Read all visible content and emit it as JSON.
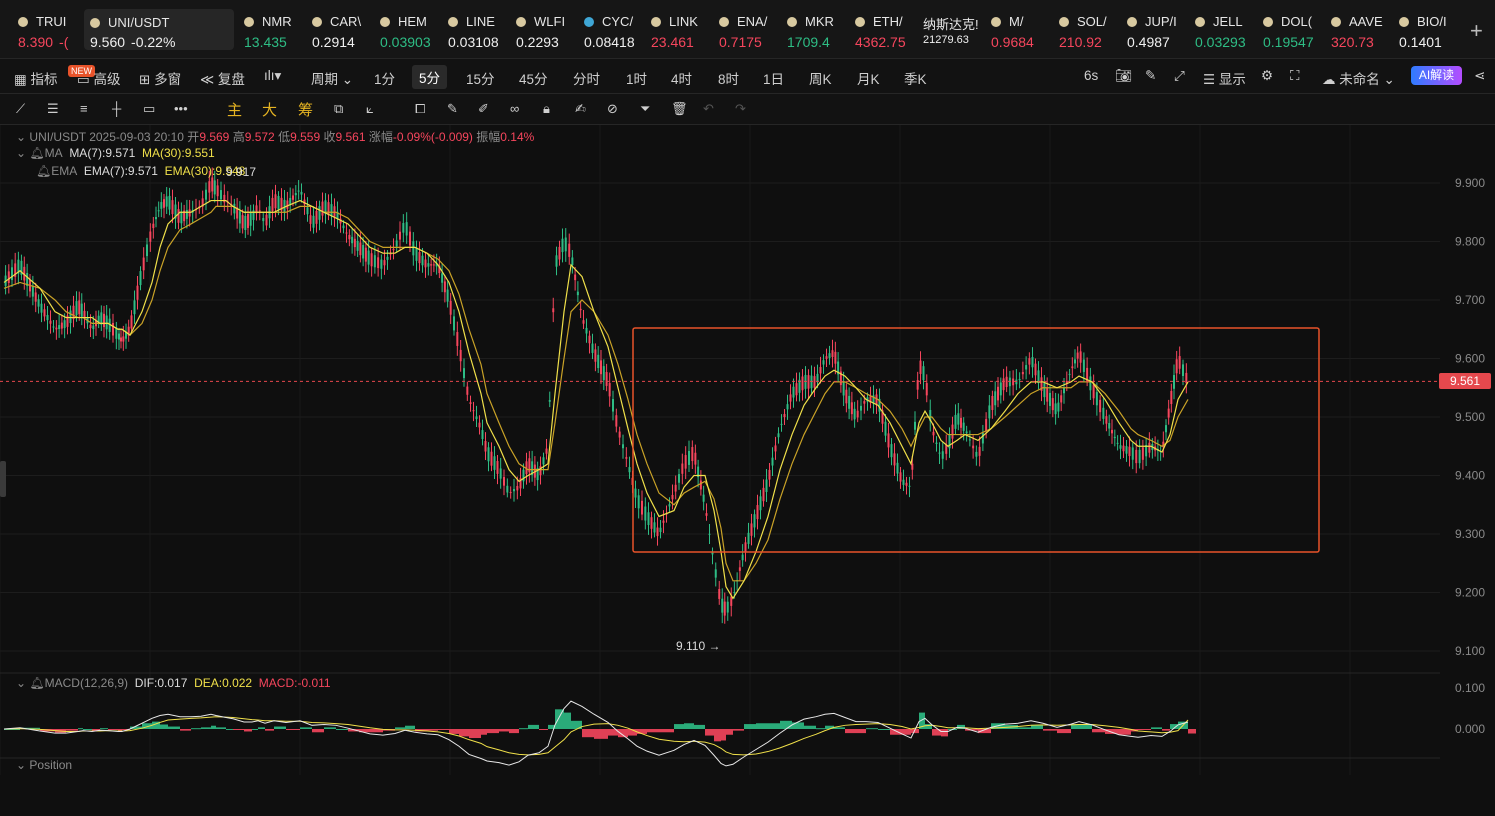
{
  "ticker": {
    "items": [
      {
        "symbol": "TRUI",
        "price": "8.390",
        "change": "-(",
        "dir": "dn"
      },
      {
        "symbol": "UNI/USDT",
        "price": "9.560",
        "change": "-0.22%",
        "dir": "wh"
      },
      {
        "symbol": "NMR",
        "price": "13.435",
        "change": "",
        "dir": "up"
      },
      {
        "symbol": "CAR\\",
        "price": "0.2914",
        "change": "",
        "dir": "wh"
      },
      {
        "symbol": "HEM",
        "price": "0.03903",
        "change": "",
        "dir": "up"
      },
      {
        "symbol": "LINE",
        "price": "0.03108",
        "change": "",
        "dir": "wh"
      },
      {
        "symbol": "WLFI",
        "price": "0.2293",
        "change": "",
        "dir": "wh"
      },
      {
        "symbol": "CYC/",
        "price": "0.08418",
        "change": "",
        "dir": "wh"
      },
      {
        "symbol": "LINK",
        "price": "23.461",
        "change": "",
        "dir": "dn"
      },
      {
        "symbol": "ENA/",
        "price": "0.7175",
        "change": "",
        "dir": "dn"
      },
      {
        "symbol": "MKR",
        "price": "1709.4",
        "change": "",
        "dir": "up"
      },
      {
        "symbol": "ETH/",
        "price": "4362.75",
        "change": "",
        "dir": "dn"
      },
      {
        "symbol": "纳斯达克!",
        "price": "21279.63",
        "change": "",
        "dir": "wh"
      },
      {
        "symbol": "M/",
        "price": "0.9684",
        "change": "",
        "dir": "dn"
      },
      {
        "symbol": "SOL/",
        "price": "210.92",
        "change": "",
        "dir": "dn"
      },
      {
        "symbol": "JUP/I",
        "price": "0.4987",
        "change": "",
        "dir": "wh"
      },
      {
        "symbol": "JELL",
        "price": "0.03293",
        "change": "",
        "dir": "up"
      },
      {
        "symbol": "DOL(",
        "price": "0.19547",
        "change": "",
        "dir": "up"
      },
      {
        "symbol": "AAVE",
        "price": "320.73",
        "change": "",
        "dir": "dn"
      },
      {
        "symbol": "BIO/I",
        "price": "0.1401",
        "change": "",
        "dir": "wh"
      }
    ],
    "add_label": "+"
  },
  "toolbar": {
    "indicator": "指标",
    "new_badge": "NEW",
    "advanced": "高级",
    "multi": "多窗",
    "replay": "复盘",
    "chart_type": "▾",
    "period": "周期",
    "intervals": [
      "1分",
      "5分",
      "15分",
      "45分",
      "分时",
      "1时",
      "4时",
      "8时",
      "1日",
      "周K",
      "月K",
      "季K"
    ],
    "selected_interval": "5分",
    "refresh": "6s",
    "display": "显示",
    "layout_name": "未命名",
    "ai": "AI解读"
  },
  "drawbar": {
    "main": "主",
    "big": "大",
    "chip": "筹"
  },
  "chart": {
    "pair_line": {
      "pair": "UNI/USDT",
      "datetime": "2025-09-03 20:10",
      "open_l": "开",
      "open": "9.569",
      "high_l": "高",
      "high": "9.572",
      "low_l": "低",
      "low": "9.559",
      "close_l": "收",
      "close": "9.561",
      "chg_l": "涨幅",
      "chg": "-0.09%(-0.009)",
      "amp_l": "振幅",
      "amp": "0.14%"
    },
    "ma_line": {
      "name": "MA",
      "ma7": "MA(7):9.571",
      "ma30": "MA(30):9.551"
    },
    "ema_line": {
      "name": "EMA",
      "ema7": "EMA(7):9.571",
      "ema30": "EMA(30):9.548"
    },
    "high_marker": "9.917",
    "low_marker": "9.110 →",
    "last_price": "9.561",
    "price_axis": [
      "9.900",
      "9.800",
      "9.700",
      "9.600",
      "9.500",
      "9.400",
      "9.300",
      "9.200",
      "9.100"
    ],
    "macd_line": {
      "name": "MACD(12,26,9)",
      "dif": "DIF:0.017",
      "dea": "DEA:0.022",
      "macd": "MACD:-0.011"
    },
    "macd_axis": [
      "0.100",
      "0.000"
    ],
    "position_label": "Position",
    "colors": {
      "up": "#2ebd85",
      "down": "#f6465d",
      "ma7": "#f0e04a",
      "ma30": "#c9a227",
      "box": "#e8532a"
    }
  },
  "chart_data": {
    "type": "line",
    "title": "UNI/USDT",
    "ylim": [
      9.07,
      9.96
    ],
    "x": [
      0,
      16,
      36,
      51,
      62,
      74,
      79,
      88,
      96,
      104,
      114,
      118,
      126,
      138,
      148,
      156,
      164,
      176,
      187,
      197,
      207,
      212,
      222,
      229,
      240,
      248,
      254,
      261,
      270,
      282,
      296,
      308,
      320,
      332,
      344,
      355,
      366,
      379,
      391,
      401,
      411,
      423,
      434,
      445,
      455,
      465,
      477,
      483,
      495,
      505,
      515,
      524,
      535,
      544,
      551,
      560,
      567,
      578,
      590,
      604,
      614,
      624,
      633,
      643,
      655,
      670,
      680,
      690,
      701,
      710,
      717,
      722,
      729,
      740,
      752,
      764,
      776,
      788,
      800,
      812,
      821,
      830,
      841,
      852,
      862,
      874,
      886,
      898,
      907,
      915,
      921,
      928,
      937,
      944,
      953,
      961,
      974,
      987,
      1001,
      1014,
      1027,
      1039,
      1053,
      1067,
      1075,
      1088,
      1101,
      1115,
      1127,
      1134,
      1147,
      1158,
      1166,
      1174,
      1184
    ],
    "close": [
      9.73,
      9.76,
      9.69,
      9.65,
      9.66,
      9.69,
      9.68,
      9.65,
      9.67,
      9.66,
      9.64,
      9.63,
      9.65,
      9.75,
      9.82,
      9.86,
      9.87,
      9.84,
      9.85,
      9.86,
      9.9,
      9.89,
      9.87,
      9.86,
      9.83,
      9.84,
      9.86,
      9.83,
      9.87,
      9.86,
      9.89,
      9.83,
      9.86,
      9.85,
      9.81,
      9.79,
      9.77,
      9.76,
      9.79,
      9.83,
      9.78,
      9.76,
      9.76,
      9.7,
      9.62,
      9.53,
      9.48,
      9.44,
      9.41,
      9.37,
      9.38,
      9.42,
      9.4,
      9.45,
      9.76,
      9.8,
      9.78,
      9.67,
      9.61,
      9.56,
      9.48,
      9.42,
      9.36,
      9.33,
      9.3,
      9.37,
      9.42,
      9.44,
      9.35,
      9.25,
      9.18,
      9.17,
      9.19,
      9.27,
      9.33,
      9.39,
      9.48,
      9.54,
      9.56,
      9.56,
      9.6,
      9.61,
      9.54,
      9.5,
      9.53,
      9.53,
      9.45,
      9.39,
      9.38,
      9.59,
      9.57,
      9.48,
      9.43,
      9.45,
      9.5,
      9.48,
      9.43,
      9.52,
      9.56,
      9.56,
      9.6,
      9.55,
      9.51,
      9.58,
      9.61,
      9.55,
      9.5,
      9.45,
      9.44,
      9.43,
      9.45,
      9.44,
      9.52,
      9.6,
      9.56
    ],
    "ma7": [
      9.73,
      9.75,
      9.72,
      9.68,
      9.67,
      9.67,
      9.67,
      9.67,
      9.66,
      9.66,
      9.65,
      9.65,
      9.64,
      9.68,
      9.73,
      9.79,
      9.83,
      9.85,
      9.85,
      9.86,
      9.87,
      9.87,
      9.87,
      9.86,
      9.85,
      9.85,
      9.85,
      9.85,
      9.85,
      9.86,
      9.87,
      9.86,
      9.85,
      9.84,
      9.83,
      9.81,
      9.79,
      9.78,
      9.78,
      9.79,
      9.79,
      9.78,
      9.76,
      9.73,
      9.68,
      9.61,
      9.54,
      9.49,
      9.45,
      9.41,
      9.39,
      9.4,
      9.41,
      9.42,
      9.54,
      9.68,
      9.76,
      9.74,
      9.68,
      9.62,
      9.55,
      9.48,
      9.42,
      9.37,
      9.33,
      9.34,
      9.38,
      9.4,
      9.4,
      9.34,
      9.27,
      9.21,
      9.19,
      9.22,
      9.27,
      9.33,
      9.41,
      9.47,
      9.52,
      9.55,
      9.57,
      9.58,
      9.57,
      9.55,
      9.53,
      9.52,
      9.49,
      9.45,
      9.42,
      9.49,
      9.51,
      9.49,
      9.46,
      9.45,
      9.46,
      9.47,
      9.46,
      9.48,
      9.51,
      9.54,
      9.56,
      9.56,
      9.55,
      9.56,
      9.57,
      9.56,
      9.53,
      9.49,
      9.46,
      9.45,
      9.45,
      9.44,
      9.47,
      9.53,
      9.56
    ],
    "ma30": [
      9.72,
      9.73,
      9.72,
      9.7,
      9.68,
      9.67,
      9.67,
      9.66,
      9.66,
      9.66,
      9.65,
      9.65,
      9.64,
      9.66,
      9.7,
      9.75,
      9.79,
      9.82,
      9.83,
      9.84,
      9.85,
      9.86,
      9.86,
      9.86,
      9.85,
      9.85,
      9.85,
      9.85,
      9.85,
      9.85,
      9.86,
      9.86,
      9.85,
      9.85,
      9.84,
      9.82,
      9.8,
      9.79,
      9.79,
      9.79,
      9.79,
      9.78,
      9.77,
      9.75,
      9.71,
      9.65,
      9.59,
      9.54,
      9.49,
      9.45,
      9.42,
      9.41,
      9.41,
      9.41,
      9.49,
      9.6,
      9.68,
      9.7,
      9.68,
      9.64,
      9.59,
      9.53,
      9.47,
      9.42,
      9.37,
      9.35,
      9.37,
      9.38,
      9.39,
      9.36,
      9.31,
      9.25,
      9.22,
      9.22,
      9.25,
      9.29,
      9.36,
      9.42,
      9.47,
      9.51,
      9.54,
      9.56,
      9.56,
      9.55,
      9.54,
      9.53,
      9.51,
      9.48,
      9.45,
      9.48,
      9.5,
      9.5,
      9.48,
      9.47,
      9.47,
      9.47,
      9.47,
      9.48,
      9.5,
      9.52,
      9.54,
      9.55,
      9.55,
      9.55,
      9.56,
      9.56,
      9.54,
      9.51,
      9.48,
      9.47,
      9.46,
      9.45,
      9.46,
      9.5,
      9.53
    ],
    "macd_hist": [
      0.0,
      0.003,
      -0.006,
      -0.009,
      -0.004,
      0.002,
      0.0,
      -0.004,
      0.002,
      -0.002,
      -0.004,
      -0.002,
      0.006,
      0.014,
      0.018,
      0.011,
      0.006,
      -0.004,
      0.002,
      0.004,
      0.008,
      0.004,
      0.0,
      -0.002,
      -0.006,
      0.0,
      0.004,
      -0.004,
      0.006,
      -0.002,
      0.004,
      -0.008,
      0.004,
      0.0,
      -0.006,
      -0.008,
      -0.008,
      -0.004,
      0.004,
      0.008,
      -0.006,
      -0.004,
      -0.002,
      -0.012,
      -0.018,
      -0.022,
      -0.014,
      -0.01,
      -0.006,
      -0.01,
      0.002,
      0.01,
      -0.002,
      0.01,
      0.048,
      0.04,
      0.02,
      -0.02,
      -0.024,
      -0.016,
      -0.02,
      -0.016,
      -0.012,
      -0.008,
      -0.008,
      0.012,
      0.014,
      0.01,
      -0.016,
      -0.03,
      -0.028,
      -0.014,
      -0.004,
      0.012,
      0.014,
      0.014,
      0.02,
      0.016,
      0.008,
      0.002,
      0.008,
      0.004,
      -0.01,
      -0.01,
      0.002,
      0.0,
      -0.014,
      -0.014,
      -0.01,
      0.04,
      0.012,
      -0.016,
      -0.018,
      0.0,
      0.01,
      -0.004,
      -0.01,
      0.014,
      0.01,
      0.004,
      0.01,
      -0.004,
      -0.01,
      0.012,
      0.01,
      -0.008,
      -0.012,
      -0.014,
      -0.006,
      -0.002,
      0.004,
      -0.004,
      0.012,
      0.018,
      -0.011
    ],
    "dif": [
      0.0,
      0.003,
      -0.005,
      -0.01,
      -0.01,
      -0.006,
      -0.004,
      -0.006,
      -0.003,
      -0.004,
      -0.006,
      -0.006,
      0.0,
      0.014,
      0.026,
      0.033,
      0.036,
      0.03,
      0.03,
      0.031,
      0.036,
      0.033,
      0.028,
      0.025,
      0.017,
      0.017,
      0.02,
      0.014,
      0.02,
      0.016,
      0.02,
      0.009,
      0.011,
      0.009,
      0.002,
      -0.005,
      -0.012,
      -0.015,
      -0.011,
      -0.003,
      -0.008,
      -0.012,
      -0.014,
      -0.026,
      -0.042,
      -0.062,
      -0.072,
      -0.078,
      -0.082,
      -0.088,
      -0.08,
      -0.064,
      -0.058,
      -0.042,
      0.01,
      0.05,
      0.068,
      0.055,
      0.036,
      0.016,
      -0.006,
      -0.024,
      -0.042,
      -0.054,
      -0.064,
      -0.052,
      -0.038,
      -0.028,
      -0.04,
      -0.064,
      -0.084,
      -0.09,
      -0.086,
      -0.068,
      -0.05,
      -0.032,
      -0.01,
      0.01,
      0.024,
      0.03,
      0.036,
      0.038,
      0.028,
      0.018,
      0.018,
      0.016,
      0.002,
      -0.012,
      -0.022,
      0.018,
      0.026,
      0.01,
      -0.006,
      -0.006,
      0.004,
      0.002,
      -0.008,
      0.004,
      0.012,
      0.014,
      0.02,
      0.014,
      0.004,
      0.012,
      0.018,
      0.01,
      -0.002,
      -0.014,
      -0.018,
      -0.02,
      -0.016,
      -0.018,
      -0.006,
      0.01,
      0.017
    ],
    "dea": [
      0.0,
      0.001,
      -0.001,
      -0.004,
      -0.006,
      -0.006,
      -0.005,
      -0.005,
      -0.005,
      -0.004,
      -0.005,
      -0.005,
      -0.004,
      0.002,
      0.009,
      0.016,
      0.022,
      0.024,
      0.026,
      0.027,
      0.029,
      0.03,
      0.029,
      0.028,
      0.025,
      0.023,
      0.022,
      0.02,
      0.02,
      0.019,
      0.019,
      0.016,
      0.015,
      0.013,
      0.011,
      0.007,
      0.003,
      -0.001,
      -0.002,
      -0.002,
      -0.003,
      -0.005,
      -0.007,
      -0.011,
      -0.017,
      -0.026,
      -0.035,
      -0.043,
      -0.051,
      -0.058,
      -0.062,
      -0.063,
      -0.062,
      -0.058,
      -0.044,
      -0.026,
      -0.007,
      0.006,
      0.012,
      0.013,
      0.009,
      0.002,
      -0.007,
      -0.016,
      -0.025,
      -0.03,
      -0.031,
      -0.03,
      -0.032,
      -0.038,
      -0.047,
      -0.056,
      -0.062,
      -0.063,
      -0.061,
      -0.055,
      -0.046,
      -0.035,
      -0.023,
      -0.013,
      -0.004,
      0.004,
      0.009,
      0.011,
      0.012,
      0.013,
      0.011,
      0.006,
      0.0,
      0.004,
      0.008,
      0.009,
      0.006,
      0.003,
      0.003,
      0.003,
      0.001,
      0.002,
      0.004,
      0.006,
      0.009,
      0.01,
      0.009,
      0.01,
      0.011,
      0.011,
      0.008,
      0.004,
      -0.001,
      -0.005,
      -0.007,
      -0.009,
      -0.008,
      -0.004,
      0.022
    ]
  }
}
